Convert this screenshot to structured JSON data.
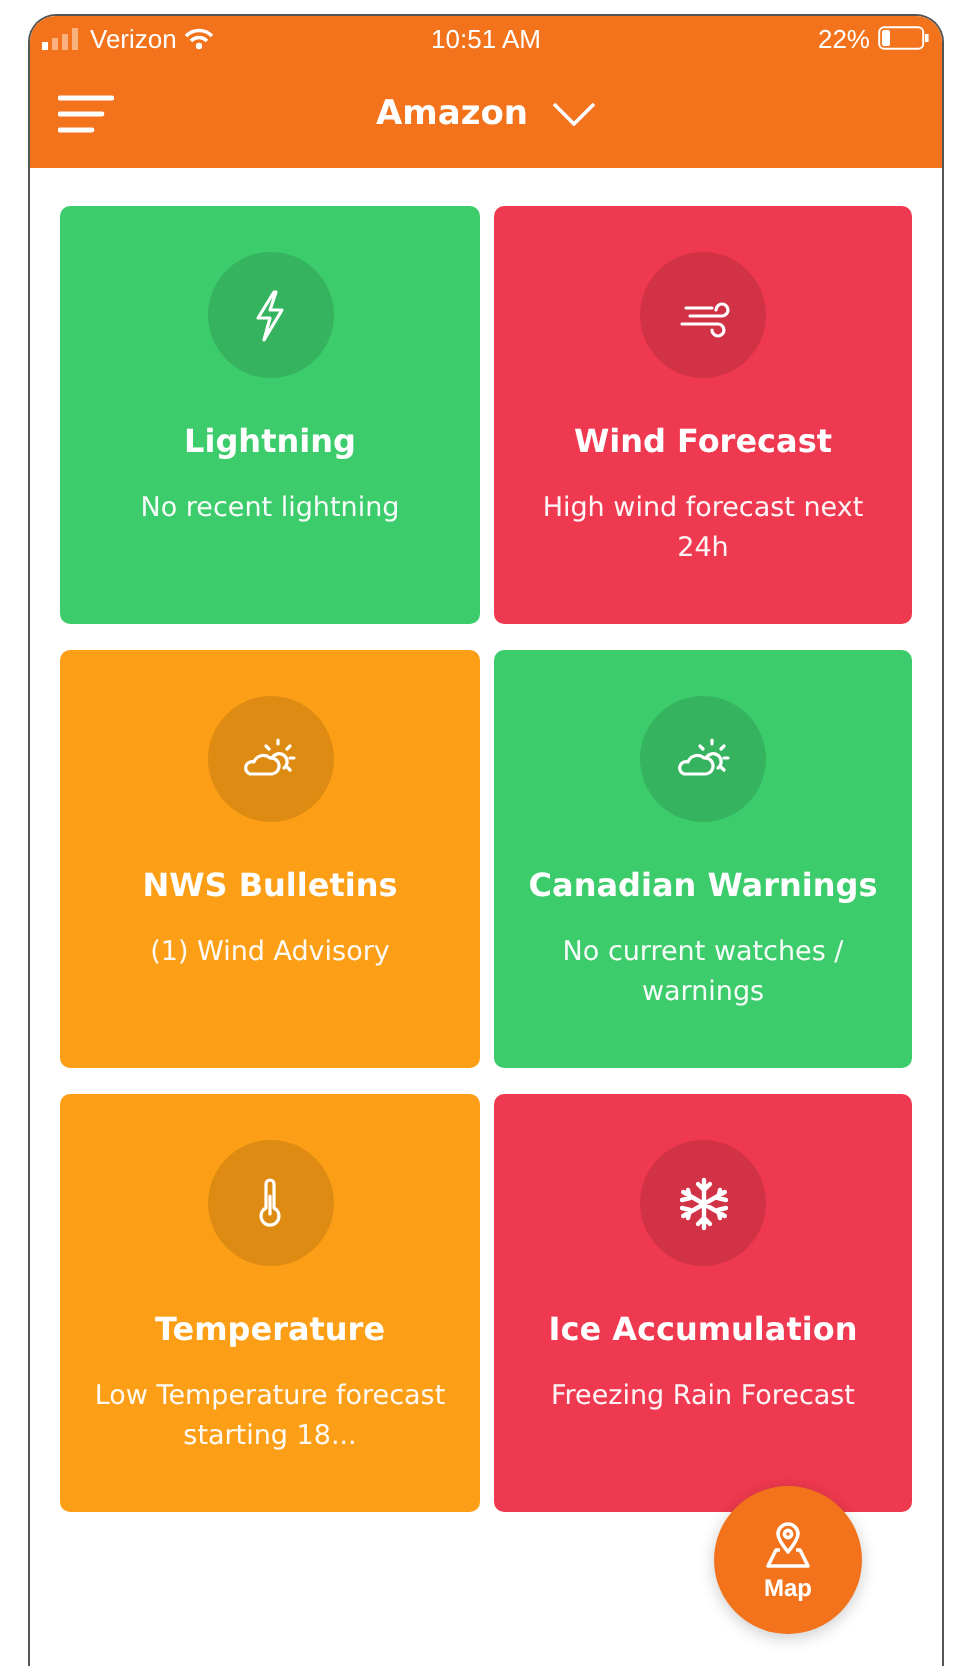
{
  "status_bar": {
    "carrier": "Verizon",
    "time": "10:51 AM",
    "battery": "22%"
  },
  "header": {
    "title": "Amazon"
  },
  "cards": [
    {
      "kind": "lightning",
      "title": "Lightning",
      "subtitle": "No recent lightning",
      "color": "#3dcc6c"
    },
    {
      "kind": "wind",
      "title": "Wind Forecast",
      "subtitle": "High wind forecast next 24h",
      "color": "#ef3950"
    },
    {
      "kind": "weather",
      "title": "NWS Bulletins",
      "subtitle": "(1) Wind Advisory",
      "color": "#fd9f16"
    },
    {
      "kind": "weather",
      "title": "Canadian Warnings",
      "subtitle": "No current watches / warnings",
      "color": "#3dcc6c"
    },
    {
      "kind": "thermometer",
      "title": "Temperature",
      "subtitle": "Low Temperature forecast starting 18...",
      "color": "#fd9f16"
    },
    {
      "kind": "snowflake",
      "title": "Ice Accumulation",
      "subtitle": "Freezing Rain Forecast",
      "color": "#ef3950"
    }
  ],
  "map_button": {
    "label": "Map"
  }
}
